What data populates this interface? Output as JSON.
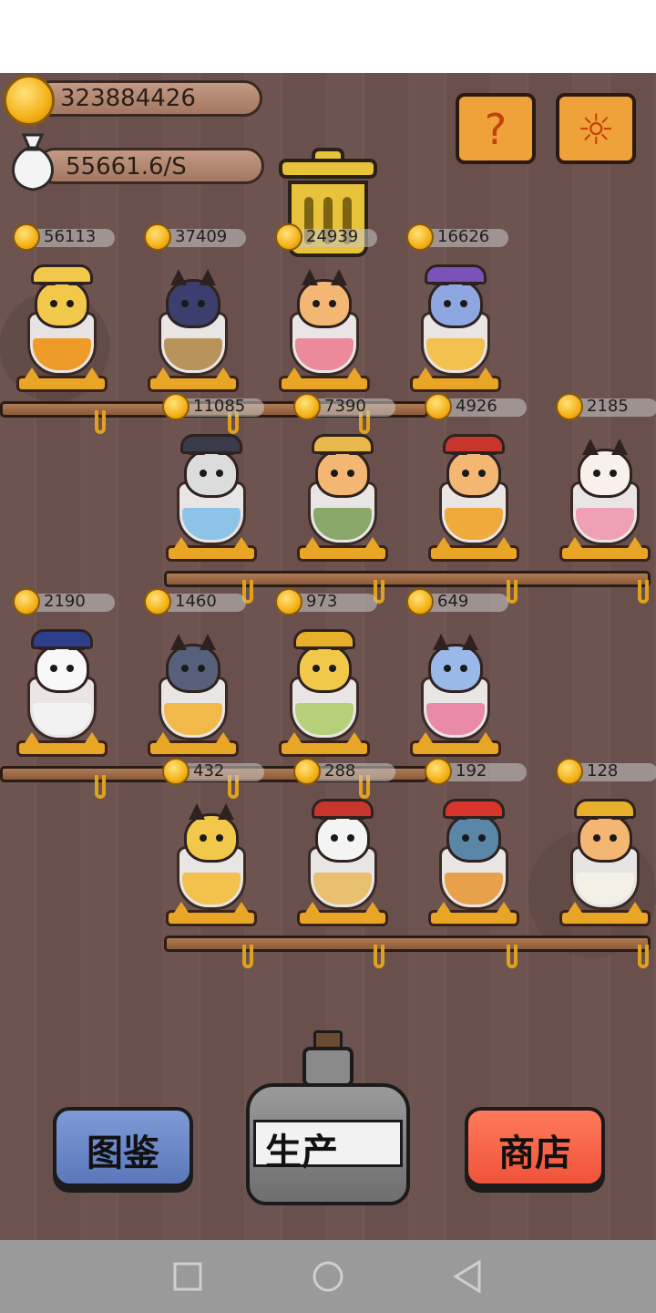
{
  "resources": {
    "coins": "323884426",
    "rate": "55661.6/S"
  },
  "buttons": {
    "help_glyph": "?",
    "settings_glyph": "☼",
    "collection_label": "图鉴",
    "produce_label": "生产",
    "shop_label": "商店"
  },
  "cats": [
    {
      "price": "56113",
      "cup": "#ef9b2a",
      "fur": "#f2c84b",
      "hat": "#f2c84b"
    },
    {
      "price": "37409",
      "cup": "#b9935c",
      "fur": "#3c3f6e",
      "hat": ""
    },
    {
      "price": "24939",
      "cup": "#ea8a9a",
      "fur": "#f4b773",
      "hat": ""
    },
    {
      "price": "16626",
      "cup": "#f2c14e",
      "fur": "#8fa7e0",
      "hat": "#7a52b8"
    },
    {
      "price": "11085",
      "cup": "#8ec3e8",
      "fur": "#dcdcdc",
      "hat": "#3a3a48"
    },
    {
      "price": "7390",
      "cup": "#8aa86a",
      "fur": "#f4b773",
      "hat": "#e8b84a"
    },
    {
      "price": "4926",
      "cup": "#f0a93c",
      "fur": "#f4b773",
      "hat": "#c8352c"
    },
    {
      "price": "2185",
      "cup": "#f0a0b4",
      "fur": "#f8f0ea",
      "hat": ""
    },
    {
      "price": "2190",
      "cup": "#f2f2f2",
      "fur": "#f8f8f8",
      "hat": "#2d3e8a"
    },
    {
      "price": "1460",
      "cup": "#f2b84a",
      "fur": "#56607a",
      "hat": ""
    },
    {
      "price": "973",
      "cup": "#b6d07a",
      "fur": "#f2c84b",
      "hat": "#e8b02a"
    },
    {
      "price": "649",
      "cup": "#e88aa8",
      "fur": "#9ab8e8",
      "hat": ""
    },
    {
      "price": "432",
      "cup": "#f2c14e",
      "fur": "#f2c84b",
      "hat": ""
    },
    {
      "price": "288",
      "cup": "#e8c070",
      "fur": "#f4f4f4",
      "hat": "#c8352c"
    },
    {
      "price": "192",
      "cup": "#e8a04a",
      "fur": "#5a86a8",
      "hat": "#d8352c"
    },
    {
      "price": "128",
      "cup": "#f4f0e6",
      "fur": "#f4b773",
      "hat": "#e8b02a"
    }
  ]
}
